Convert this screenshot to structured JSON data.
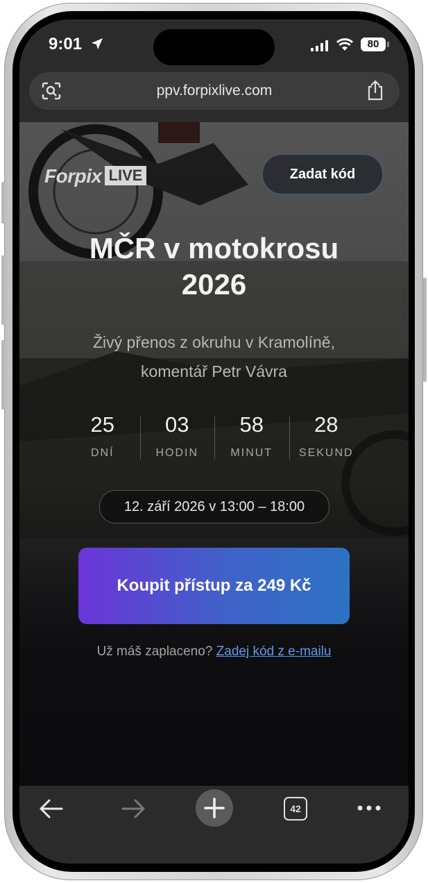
{
  "status_bar": {
    "time": "9:01",
    "battery": "80"
  },
  "browser": {
    "url": "ppv.forpixlive.com",
    "tab_count": "42"
  },
  "header": {
    "logo_main": "Forpix",
    "logo_badge": "LIVE",
    "code_button": "Zadat kód"
  },
  "event": {
    "title_line1": "MČR v motokrosu",
    "title_line2": "2026",
    "subtitle_line1": "Živý přenos z okruhu v Kramolíně,",
    "subtitle_line2": "komentář Petr Vávra",
    "date": "12. září 2026 v 13:00 – 18:00"
  },
  "countdown": [
    {
      "value": "25",
      "label": "DNÍ"
    },
    {
      "value": "03",
      "label": "HODIN"
    },
    {
      "value": "58",
      "label": "MINUT"
    },
    {
      "value": "28",
      "label": "SEKUND"
    }
  ],
  "purchase": {
    "button": "Koupit přístup za 249 Kč",
    "paid_text": "Už máš zaplaceno?",
    "paid_link": "Zadej kód z e-mailu"
  },
  "colors": {
    "accent_start": "#6b35d8",
    "accent_end": "#2d72c4",
    "link": "#5f98e8"
  },
  "icons": [
    "location-arrow-icon",
    "signal-icon",
    "wifi-icon",
    "visual-lookup-icon",
    "share-icon",
    "back-arrow-icon",
    "forward-arrow-icon",
    "new-tab-plus-icon",
    "tabs-icon",
    "more-icon"
  ]
}
